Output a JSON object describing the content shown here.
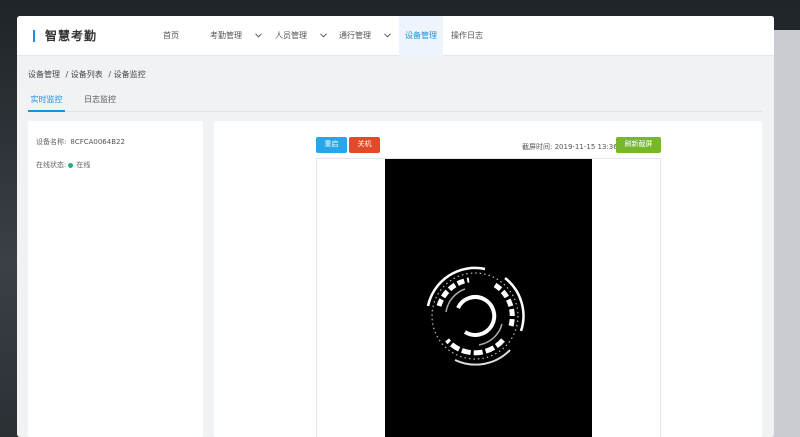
{
  "app": {
    "title": "智慧考勤"
  },
  "nav": {
    "items": [
      {
        "label": "首页",
        "dropdown": false
      },
      {
        "label": "考勤管理",
        "dropdown": true
      },
      {
        "label": "人员管理",
        "dropdown": true
      },
      {
        "label": "通行管理",
        "dropdown": true
      },
      {
        "label": "设备管理",
        "dropdown": false,
        "active": true
      },
      {
        "label": "操作日志",
        "dropdown": false
      }
    ]
  },
  "breadcrumb": [
    "设备管理",
    "/ 设备列表",
    "/ 设备监控"
  ],
  "tabs": [
    {
      "label": "实时监控",
      "active": true
    },
    {
      "label": "日志监控",
      "active": false
    }
  ],
  "device": {
    "name_label": "设备名称:",
    "name_value": "8CFCA0064B22",
    "status_label": "在线状态:",
    "status_value": "在线",
    "status_color": "#22b07d"
  },
  "controls": {
    "restart": "重启",
    "shutdown": "关机",
    "screenshot_time_label": "截屏时间:",
    "screenshot_time": "2019-11-15 13:36",
    "refresh": "刷新截屏"
  },
  "colors": {
    "accent": "#1d8fe1",
    "restart_button": "#2aa6e8",
    "shutdown_button": "#e14b2a",
    "refresh_button": "#76b82a"
  }
}
